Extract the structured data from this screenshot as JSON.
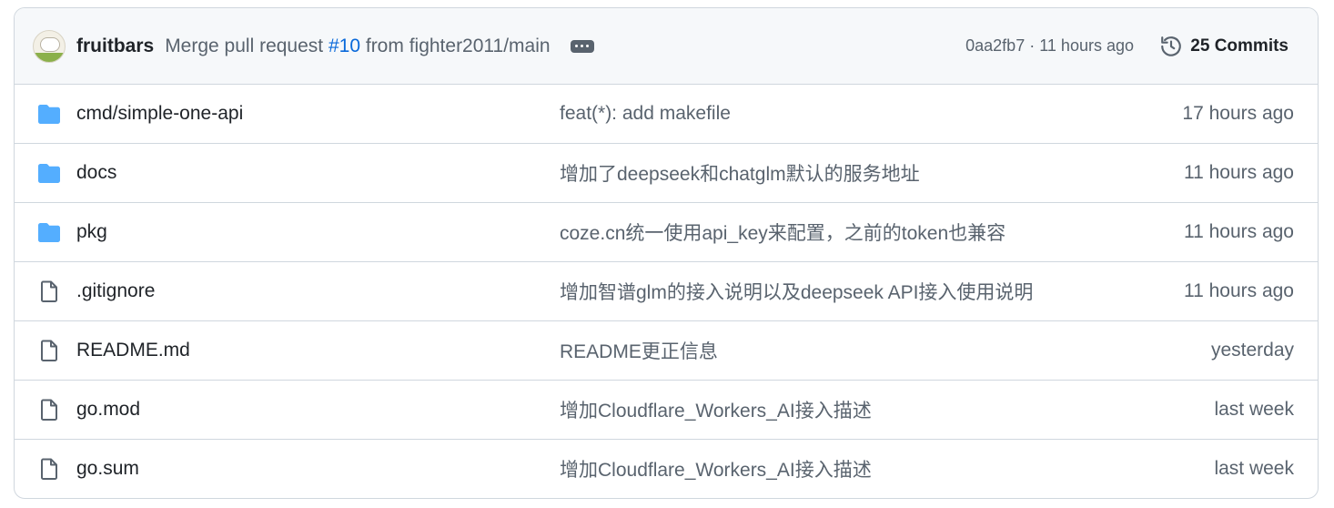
{
  "header": {
    "author": "fruitbars",
    "message_prefix": "Merge pull request",
    "pr_number": "#10",
    "message_suffix": "from fighter2011/main",
    "commit_hash": "0aa2fb7",
    "separator": "·",
    "commit_time": "11 hours ago",
    "commits_label": "25 Commits"
  },
  "files": [
    {
      "type": "folder",
      "name": "cmd/simple-one-api",
      "commit_message": "feat(*): add makefile",
      "time": "17 hours ago"
    },
    {
      "type": "folder",
      "name": "docs",
      "commit_message": "增加了deepseek和chatglm默认的服务地址",
      "time": "11 hours ago"
    },
    {
      "type": "folder",
      "name": "pkg",
      "commit_message": "coze.cn统一使用api_key来配置，之前的token也兼容",
      "time": "11 hours ago"
    },
    {
      "type": "file",
      "name": ".gitignore",
      "commit_message": "增加智谱glm的接入说明以及deepseek API接入使用说明",
      "time": "11 hours ago"
    },
    {
      "type": "file",
      "name": "README.md",
      "commit_message": "README更正信息",
      "time": "yesterday"
    },
    {
      "type": "file",
      "name": "go.mod",
      "commit_message": "增加Cloudflare_Workers_AI接入描述",
      "time": "last week"
    },
    {
      "type": "file",
      "name": "go.sum",
      "commit_message": "增加Cloudflare_Workers_AI接入描述",
      "time": "last week"
    }
  ],
  "colors": {
    "folder": "#54aeff",
    "link": "#0969da",
    "muted": "#59636e"
  }
}
